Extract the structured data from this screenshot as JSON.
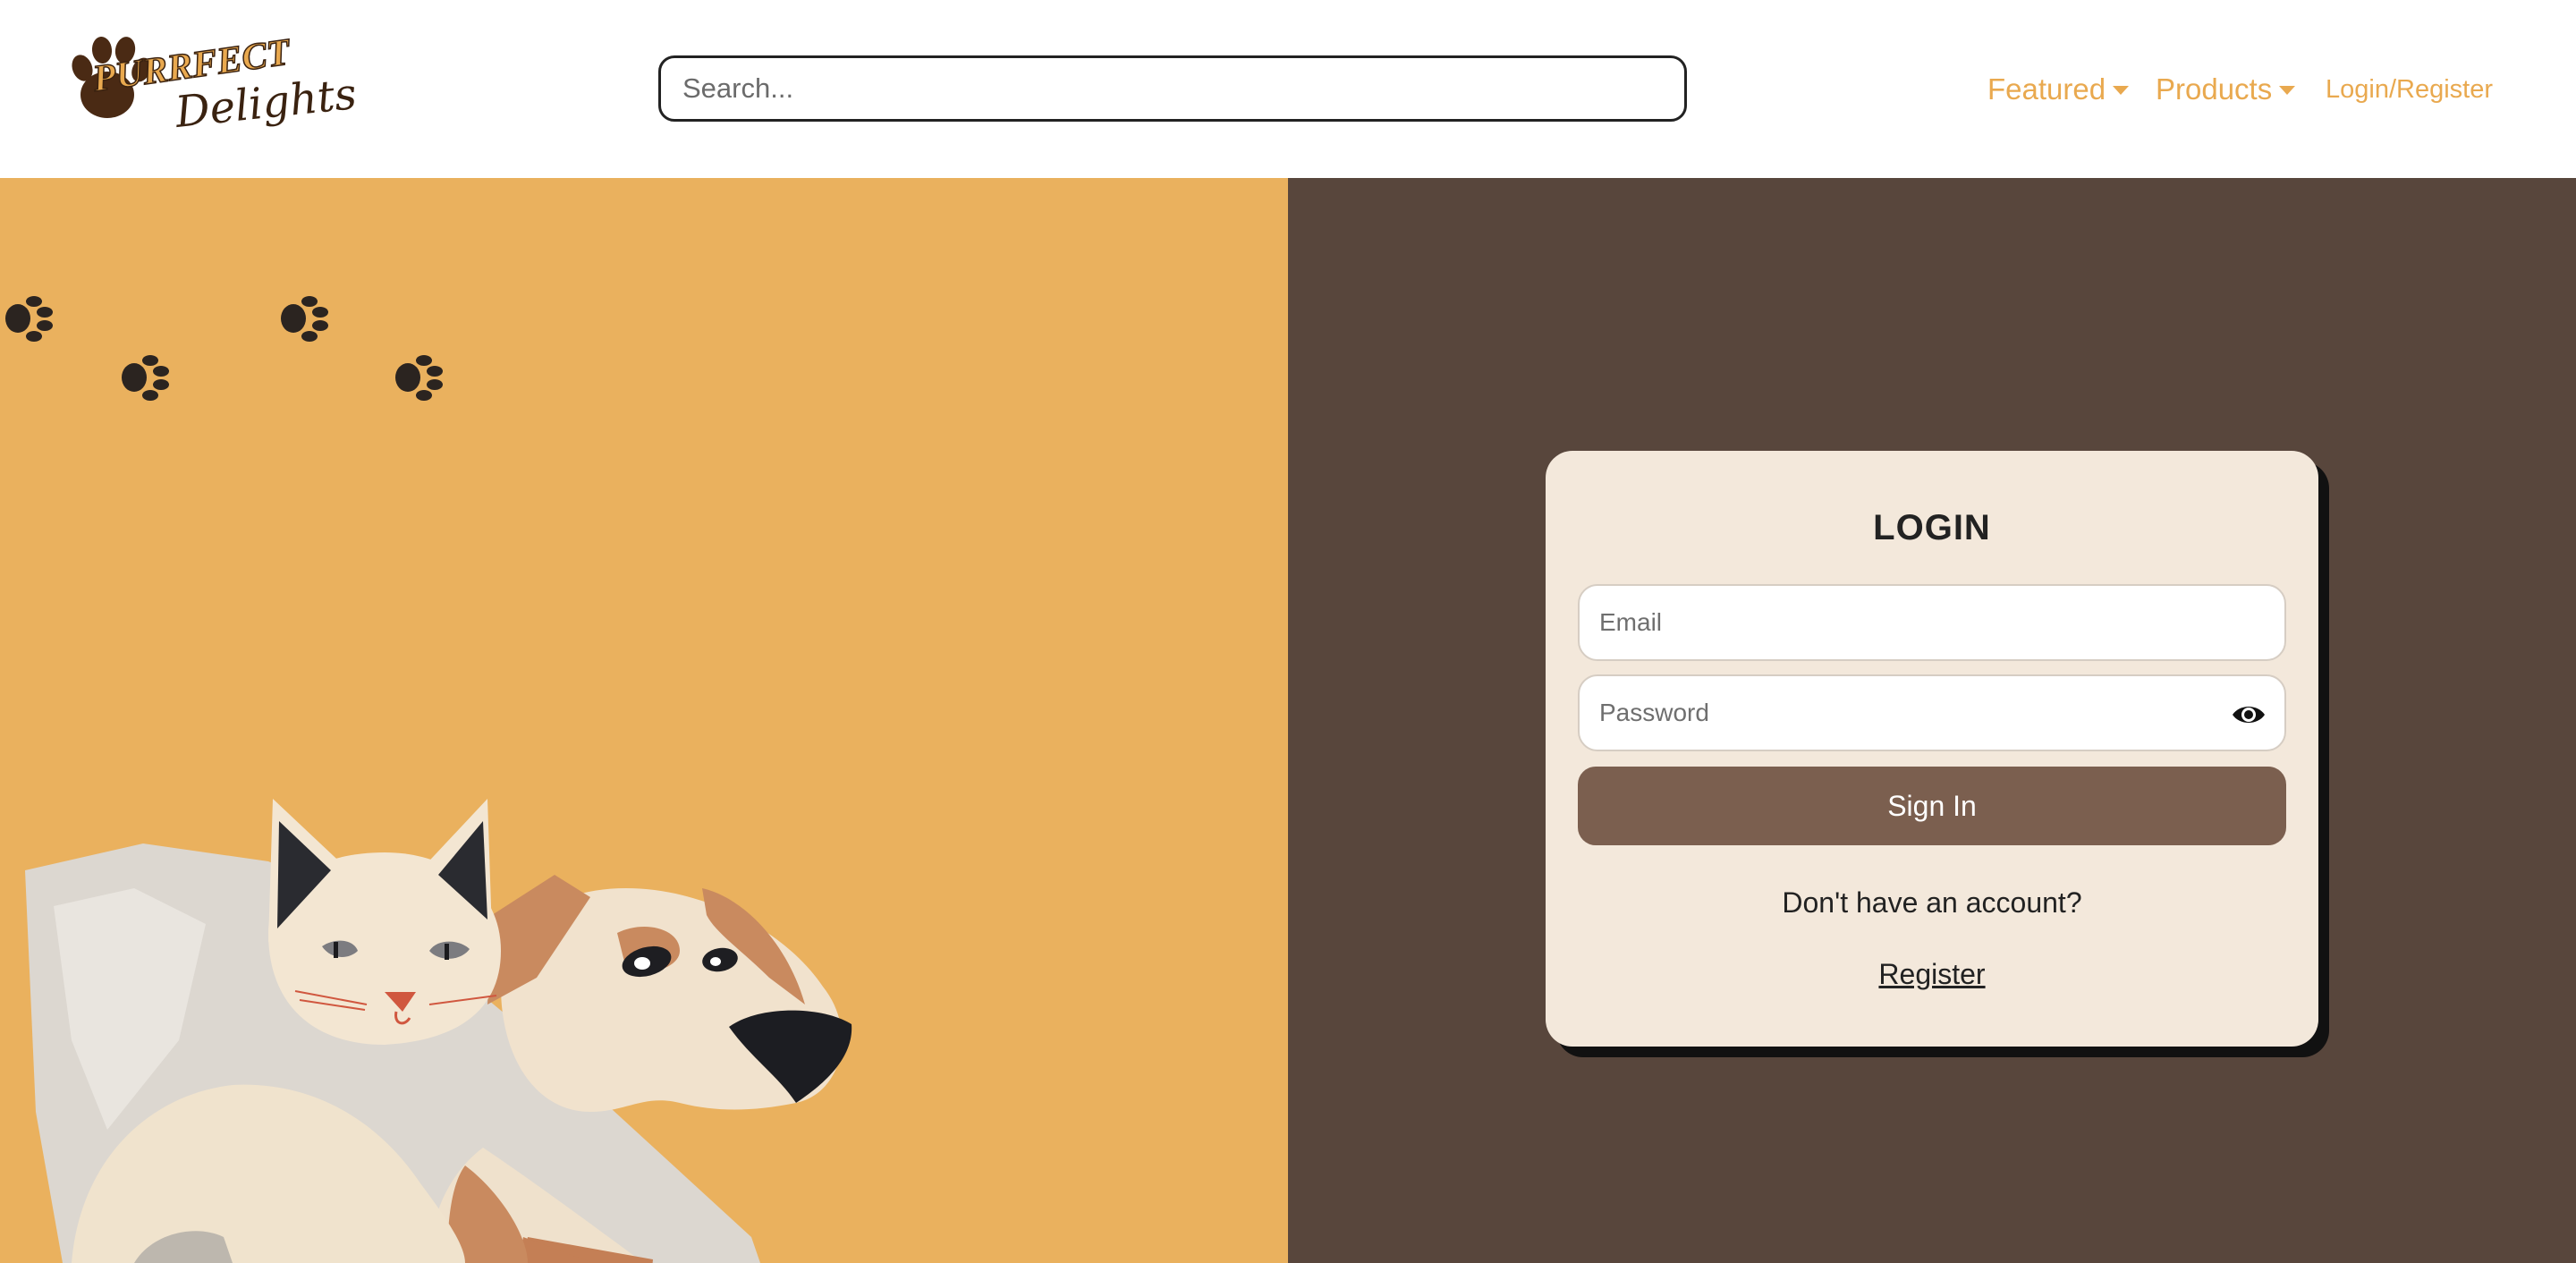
{
  "brand": {
    "logo_text_line1": "PURRFECT",
    "logo_text_line2": "Delights"
  },
  "search": {
    "placeholder": "Search...",
    "value": ""
  },
  "nav": {
    "featured_label": "Featured",
    "products_label": "Products",
    "login_register_label": "Login/Register"
  },
  "login": {
    "title": "LOGIN",
    "email_placeholder": "Email",
    "password_placeholder": "Password",
    "sign_in_label": "Sign In",
    "no_account_text": "Don't have an account?",
    "register_label": "Register"
  },
  "icons": {
    "password_toggle": "eye-icon",
    "dropdown": "caret-down-icon",
    "decor": "paw-print-icon"
  },
  "colors": {
    "accent": "#e9a94f",
    "left_panel_bg": "#eab15e",
    "right_panel_bg": "#58463c",
    "card_bg": "#f3e8db",
    "button_bg": "#7b5f4f"
  }
}
